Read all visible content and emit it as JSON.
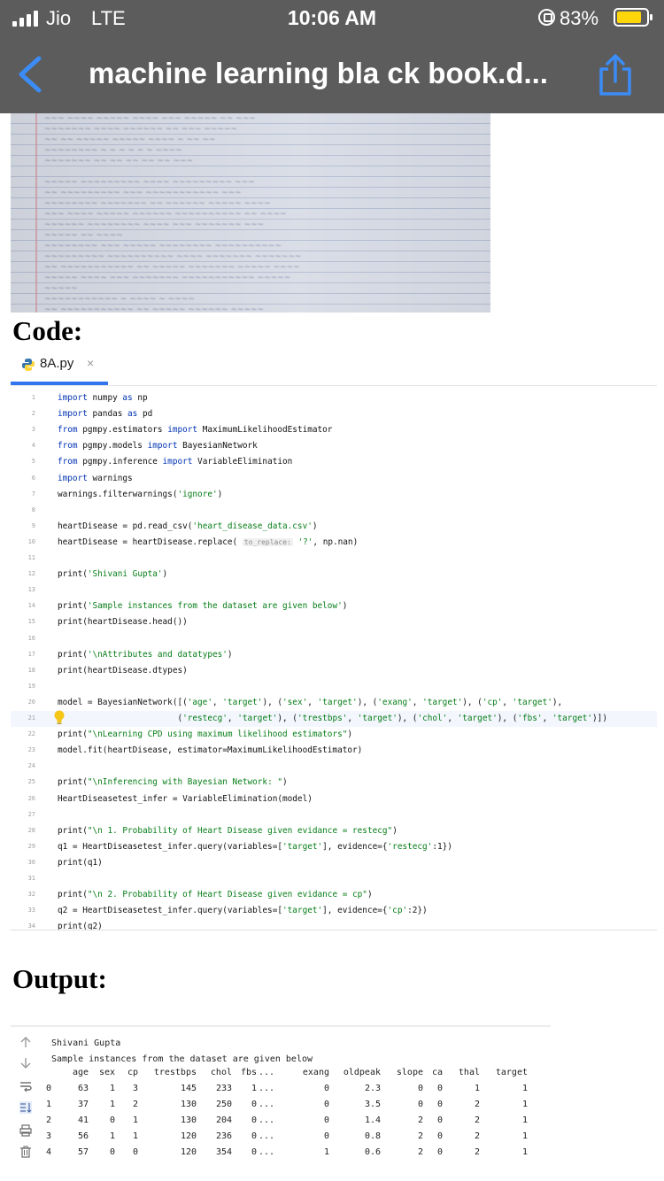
{
  "status_bar": {
    "carrier": "Jio",
    "network": "LTE",
    "time": "10:06 AM",
    "battery_percent": "83%",
    "battery_level": 0.83
  },
  "nav": {
    "title": "machine learning bla ck book.d..."
  },
  "photo": {
    "icon": "handwritten-page-photo"
  },
  "headings": {
    "code": "Code:",
    "output": "Output:"
  },
  "editor": {
    "tab_label": "8A.py",
    "tab_close": "×",
    "lines": [
      {
        "n": "1",
        "code": "import numpy as np"
      },
      {
        "n": "2",
        "code": "import pandas as pd"
      },
      {
        "n": "3",
        "code": "from pgmpy.estimators import MaximumLikelihoodEstimator"
      },
      {
        "n": "4",
        "code": "from pgmpy.models import BayesianNetwork"
      },
      {
        "n": "5",
        "code": "from pgmpy.inference import VariableElimination"
      },
      {
        "n": "6",
        "code": "import warnings"
      },
      {
        "n": "7",
        "code": "warnings.filterwarnings('ignore')"
      },
      {
        "n": "8",
        "code": ""
      },
      {
        "n": "9",
        "code": "heartDisease = pd.read_csv('heart_disease_data.csv')"
      },
      {
        "n": "10",
        "code": "heartDisease = heartDisease.replace( to_replace: '?', np.nan)"
      },
      {
        "n": "11",
        "code": ""
      },
      {
        "n": "12",
        "code": "print('Shivani Gupta')"
      },
      {
        "n": "13",
        "code": ""
      },
      {
        "n": "14",
        "code": "print('Sample instances from the dataset are given below')"
      },
      {
        "n": "15",
        "code": "print(heartDisease.head())"
      },
      {
        "n": "16",
        "code": ""
      },
      {
        "n": "17",
        "code": "print('\\nAttributes and datatypes')"
      },
      {
        "n": "18",
        "code": "print(heartDisease.dtypes)"
      },
      {
        "n": "19",
        "code": ""
      },
      {
        "n": "20",
        "code": "model = BayesianNetwork([('age', 'target'), ('sex', 'target'), ('exang', 'target'), ('cp', 'target'),"
      },
      {
        "n": "21",
        "code": "                        ('restecg', 'target'), ('trestbps', 'target'), ('chol', 'target'), ('fbs', 'target')])"
      },
      {
        "n": "22",
        "code": "print(\"\\nLearning CPD using maximum likelihood estimators\")"
      },
      {
        "n": "23",
        "code": "model.fit(heartDisease, estimator=MaximumLikelihoodEstimator)"
      },
      {
        "n": "24",
        "code": ""
      },
      {
        "n": "25",
        "code": "print(\"\\nInferencing with Bayesian Network: \")"
      },
      {
        "n": "26",
        "code": "HeartDiseasetest_infer = VariableElimination(model)"
      },
      {
        "n": "27",
        "code": ""
      },
      {
        "n": "28",
        "code": "print(\"\\n 1. Probability of Heart Disease given evidance = restecg\")"
      },
      {
        "n": "29",
        "code": "q1 = HeartDiseasetest_infer.query(variables=['target'], evidence={'restecg':1})"
      },
      {
        "n": "30",
        "code": "print(q1)"
      },
      {
        "n": "31",
        "code": ""
      },
      {
        "n": "32",
        "code": "print(\"\\n 2. Probability of Heart Disease given evidance = cp\")"
      },
      {
        "n": "33",
        "code": "q2 = HeartDiseasetest_infer.query(variables=['target'], evidence={'cp':2})"
      },
      {
        "n": "34",
        "code": "print(q2)"
      }
    ]
  },
  "output": {
    "line1": "Shivani Gupta",
    "line2": "Sample instances from the dataset are given below",
    "columns": [
      "",
      "age",
      "sex",
      "cp",
      "trestbps",
      "chol",
      "fbs",
      "...",
      "exang",
      "oldpeak",
      "slope",
      "ca",
      "thal",
      "target"
    ],
    "rows": [
      [
        "0",
        "63",
        "1",
        "3",
        "145",
        "233",
        "1",
        "...",
        "0",
        "2.3",
        "0",
        "0",
        "1",
        "1"
      ],
      [
        "1",
        "37",
        "1",
        "2",
        "130",
        "250",
        "0",
        "...",
        "0",
        "3.5",
        "0",
        "0",
        "2",
        "1"
      ],
      [
        "2",
        "41",
        "0",
        "1",
        "130",
        "204",
        "0",
        "...",
        "0",
        "1.4",
        "2",
        "0",
        "2",
        "1"
      ],
      [
        "3",
        "56",
        "1",
        "1",
        "120",
        "236",
        "0",
        "...",
        "0",
        "0.8",
        "2",
        "0",
        "2",
        "1"
      ],
      [
        "4",
        "57",
        "0",
        "0",
        "120",
        "354",
        "0",
        "...",
        "1",
        "0.6",
        "2",
        "0",
        "2",
        "1"
      ]
    ],
    "tool_icons": [
      "arrow-up-icon",
      "arrow-down-icon",
      "soft-wrap-icon",
      "scroll-to-end-icon",
      "print-icon",
      "trash-icon"
    ]
  }
}
